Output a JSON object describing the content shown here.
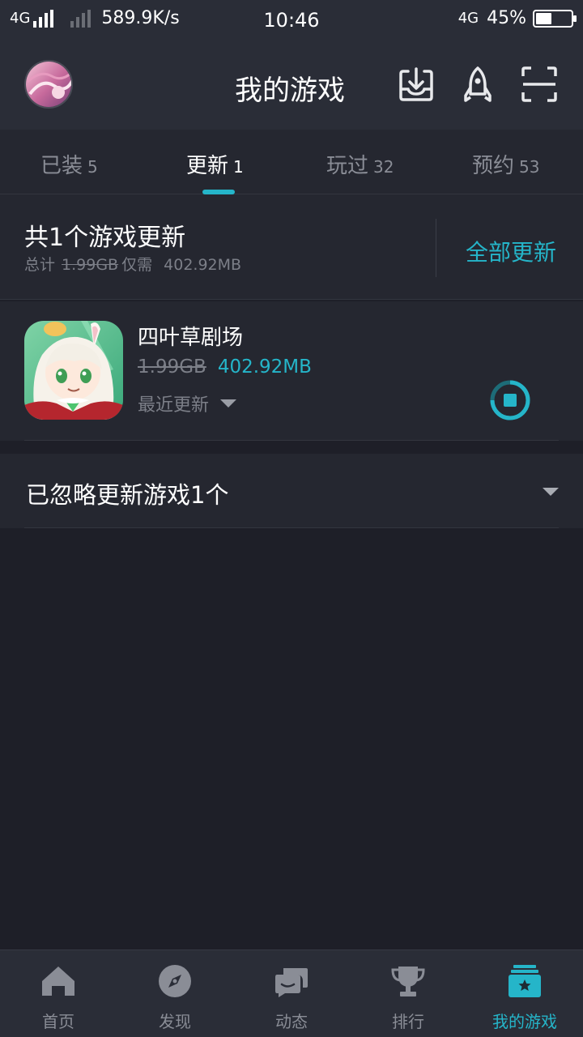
{
  "status_bar": {
    "network_left": "4G",
    "speed": "589.9K/s",
    "time": "10:46",
    "network_right": "4G",
    "battery": "45%",
    "battery_level": 0.45
  },
  "header": {
    "title": "我的游戏"
  },
  "tabs": [
    {
      "label": "已装",
      "count": "5"
    },
    {
      "label": "更新",
      "count": "1"
    },
    {
      "label": "玩过",
      "count": "32"
    },
    {
      "label": "预约",
      "count": "53"
    }
  ],
  "summary": {
    "heading": "共1个游戏更新",
    "total_label": "总计",
    "old_size": "1.99GB",
    "only_needs": "仅需",
    "new_size": "402.92MB",
    "update_all": "全部更新"
  },
  "game": {
    "name": "四叶草剧场",
    "old_size": "1.99GB",
    "new_size": "402.92MB",
    "recent_label": "最近更新"
  },
  "ignored": {
    "label": "已忽略更新游戏1个"
  },
  "bottom_nav": [
    {
      "label": "首页",
      "icon": "home-icon"
    },
    {
      "label": "发现",
      "icon": "compass-icon"
    },
    {
      "label": "动态",
      "icon": "chat-icon"
    },
    {
      "label": "排行",
      "icon": "trophy-icon"
    },
    {
      "label": "我的游戏",
      "icon": "game-box-icon"
    }
  ],
  "colors": {
    "accent": "#25b5c9",
    "background": "#1e1f28",
    "panel": "#252730",
    "bar": "#2a2d37"
  }
}
